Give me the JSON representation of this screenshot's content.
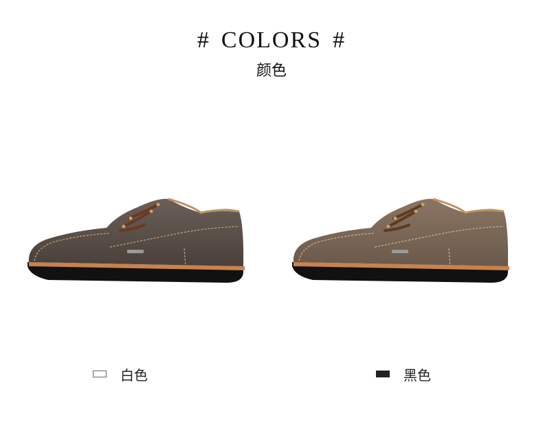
{
  "header": {
    "hash_left": "#",
    "title": "COLORS",
    "hash_right": "#",
    "subtitle": "颜色"
  },
  "products": [
    {
      "image": "shoe-dark-grey-suede",
      "color_hex": "#5d524c"
    },
    {
      "image": "shoe-taupe-suede",
      "color_hex": "#7d6a5a"
    }
  ],
  "color_options": [
    {
      "label": "白色",
      "swatch_color": "#ffffff"
    },
    {
      "label": "黑色",
      "swatch_color": "#222222"
    }
  ]
}
